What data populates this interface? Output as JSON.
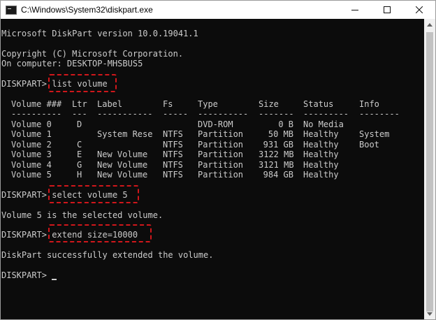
{
  "window": {
    "title": "C:\\Windows\\System32\\diskpart.exe",
    "controls": {
      "minimize": "minimize-icon",
      "maximize": "maximize-icon",
      "close": "close-icon"
    }
  },
  "console": {
    "version_line": "Microsoft DiskPart version 10.0.19041.1",
    "copyright_line": "Copyright (C) Microsoft Corporation.",
    "computer_line": "On computer: DESKTOP-MHSBUS5",
    "prompt": "DISKPART> ",
    "commands": [
      "list volume",
      "select volume 5",
      "extend size=10000"
    ],
    "table": {
      "headers": [
        "Volume ###",
        "Ltr",
        "Label",
        "Fs",
        "Type",
        "Size",
        "Status",
        "Info"
      ],
      "separators": [
        "----------",
        "---",
        "-----------",
        "-----",
        "----------",
        "-------",
        "---------",
        "--------"
      ],
      "rows": [
        [
          "Volume 0",
          "D",
          "",
          "",
          "DVD-ROM",
          "0 B",
          "No Media",
          ""
        ],
        [
          "Volume 1",
          "",
          "System Rese",
          "NTFS",
          "Partition",
          "50 MB",
          "Healthy",
          "System"
        ],
        [
          "Volume 2",
          "C",
          "",
          "NTFS",
          "Partition",
          "931 GB",
          "Healthy",
          "Boot"
        ],
        [
          "Volume 3",
          "E",
          "New Volume",
          "NTFS",
          "Partition",
          "3122 MB",
          "Healthy",
          ""
        ],
        [
          "Volume 4",
          "G",
          "New Volume",
          "NTFS",
          "Partition",
          "3121 MB",
          "Healthy",
          ""
        ],
        [
          "Volume 5",
          "H",
          "New Volume",
          "NTFS",
          "Partition",
          "984 GB",
          "Healthy",
          ""
        ]
      ]
    },
    "select_result": "Volume 5 is the selected volume.",
    "extend_result": "DiskPart successfully extended the volume.",
    "highlight_color": "#d0171b",
    "text_color": "#cccccc",
    "background_color": "#0c0c0c"
  }
}
